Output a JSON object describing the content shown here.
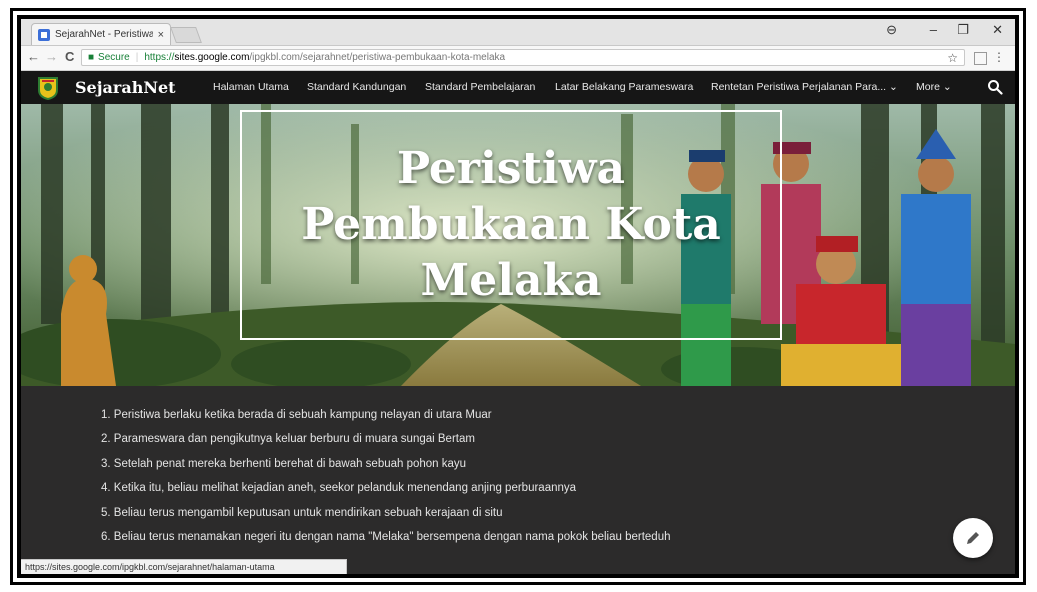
{
  "browser": {
    "tab_title": "SejarahNet - Peristiwa Pe",
    "tab_close": "×",
    "window_controls": {
      "account": "⊖",
      "minimize": "–",
      "restore": "❐",
      "close": "✕"
    },
    "back": "←",
    "forward": "→",
    "reload": "C",
    "secure_label": "Secure",
    "url_https": "https://",
    "url_host": "sites.google.com",
    "url_path": "/ipgkbl.com/sejarahnet/peristiwa-pembukaan-kota-melaka",
    "bookmark_star": "☆",
    "menu_dots": "⋮",
    "status_url": "https://sites.google.com/ipgkbl.com/sejarahnet/halaman-utama"
  },
  "site": {
    "brand": "SejarahNet",
    "nav": [
      {
        "label": "Halaman Utama"
      },
      {
        "label": "Standard Kandungan"
      },
      {
        "label": "Standard Pembelajaran"
      },
      {
        "label": "Latar Belakang Parameswara"
      },
      {
        "label": "Rentetan Peristiwa Perjalanan Para... ⌄"
      },
      {
        "label": "More ⌄"
      }
    ]
  },
  "hero": {
    "title": "Peristiwa Pembukaan Kota Melaka"
  },
  "content": {
    "items": [
      "1. Peristiwa berlaku ketika berada di sebuah kampung nelayan di utara Muar",
      "2. Parameswara dan pengikutnya keluar berburu di muara sungai Bertam",
      "3. Setelah penat mereka berhenti berehat di bawah sebuah pohon kayu",
      "4. Ketika itu, beliau melihat kejadian aneh, seekor pelanduk menendang anjing perburaannya",
      "5. Beliau terus mengambil keputusan untuk mendirikan sebuah kerajaan di situ",
      "6. Beliau terus menamakan negeri itu dengan nama \"Melaka\" bersempena dengan nama pokok beliau berteduh"
    ]
  },
  "colors": {
    "header_bg": "#161616",
    "content_bg": "#2c2b2b",
    "secure_green": "#188038"
  }
}
